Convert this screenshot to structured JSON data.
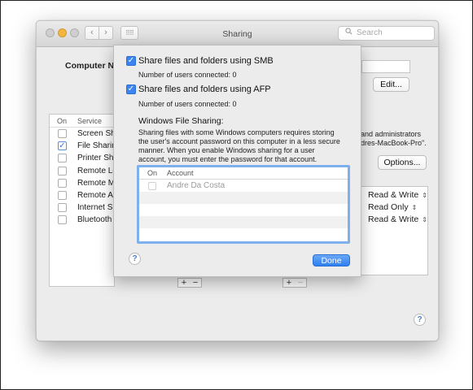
{
  "window": {
    "title": "Sharing",
    "search_placeholder": "Search",
    "nav_back": "‹",
    "nav_forward": "›",
    "grid_glyph": "⠿⠿"
  },
  "background": {
    "computer_name_label": "Computer Na",
    "edit_label": "Edit...",
    "options_label": "Options...",
    "service_list": {
      "headers": {
        "on": "On",
        "service": "Service"
      },
      "items": [
        {
          "label": "Screen Sha",
          "checked": false
        },
        {
          "label": "File Sharing",
          "checked": true
        },
        {
          "label": "Printer Sha",
          "checked": false
        },
        {
          "label": "Remote Log",
          "checked": false
        },
        {
          "label": "Remote Ma",
          "checked": false
        },
        {
          "label": "Remote Ap",
          "checked": false
        },
        {
          "label": "Internet Sh",
          "checked": false
        },
        {
          "label": "Bluetooth S",
          "checked": false
        }
      ]
    },
    "right_text_1": "and administrators",
    "right_text_2": "dres-MacBook-Pro\".",
    "permissions": [
      "Read & Write",
      "Read Only",
      "Read & Write"
    ],
    "plus": "+",
    "minus": "−"
  },
  "sheet": {
    "smb_label": "Share files and folders using SMB",
    "smb_users": "Number of users connected: 0",
    "afp_label": "Share files and folders using AFP",
    "afp_users": "Number of users connected: 0",
    "windows_heading": "Windows File Sharing:",
    "windows_desc": "Sharing files with some Windows computers requires storing the user's account password on this computer in a less secure manner.  When you enable Windows sharing for a user account, you must enter the password for that account.",
    "table": {
      "headers": {
        "on": "On",
        "account": "Account"
      },
      "rows": [
        {
          "account": "Andre Da Costa",
          "checked": false
        }
      ]
    },
    "done_label": "Done"
  },
  "help_glyph": "?",
  "colors": {
    "accent": "#3b84f1",
    "focus_ring": "#7fb0ee",
    "yellow_light": "#f4b63f"
  },
  "icons": {
    "search": "magnifier-icon",
    "check": "✓"
  }
}
